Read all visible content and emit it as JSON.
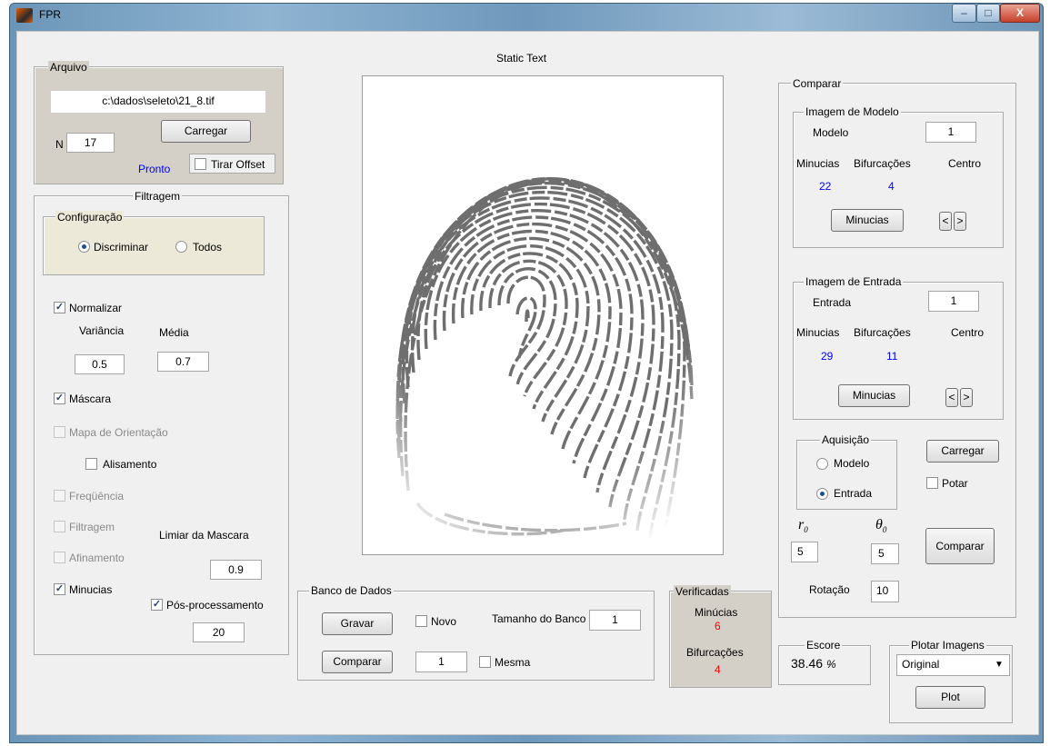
{
  "window": {
    "title": "FPR",
    "minimize": "–",
    "maximize": "□",
    "close": "X"
  },
  "arquivo": {
    "title": "Arquivo",
    "path": "c:\\dados\\seleto\\21_8.tif",
    "n_label": "N",
    "n_value": "17",
    "load_button": "Carregar",
    "status": "Pronto",
    "offset_label": "Tirar Offset"
  },
  "filtragem": {
    "title": "Filtragem",
    "config": {
      "title": "Configuração",
      "option1": "Discriminar",
      "option2": "Todos",
      "selected": "Discriminar"
    },
    "normalizar": "Normalizar",
    "variancia_label": "Variância",
    "media_label": "Média",
    "variancia_value": "0.5",
    "media_value": "0.7",
    "mascara": "Máscara",
    "mapa": "Mapa de Orientação",
    "alisamento": "Alisamento",
    "frequencia": "Freqüência",
    "filtragem_cb": "Filtragem",
    "limiar_label": "Limiar da Mascara",
    "afinamento": "Afinamento",
    "limiar_value": "0.9",
    "minucias": "Minucias",
    "pos": "Pós-processamento",
    "pos_value": "20"
  },
  "center": {
    "static_text": "Static Text"
  },
  "banco": {
    "title": "Banco de Dados",
    "gravar": "Gravar",
    "novo": "Novo",
    "tamanho_label": "Tamanho do Banco",
    "tamanho_value": "1",
    "comparar": "Comparar",
    "index_value": "1",
    "mesma": "Mesma"
  },
  "verificadas": {
    "title": "Verificadas",
    "minucias_label": "Minúcias",
    "minucias_value": "6",
    "bif_label": "Bifurcações",
    "bif_value": "4"
  },
  "comparar": {
    "title": "Comparar",
    "modelo": {
      "title": "Imagem de Modelo",
      "label": "Modelo",
      "value": "1",
      "min_label": "Minucias",
      "bif_label": "Bifurcações",
      "centro_label": "Centro",
      "min_value": "22",
      "bif_value": "4",
      "button": "Minucias",
      "prev": "<",
      "next": ">"
    },
    "entrada": {
      "title": "Imagem de Entrada",
      "label": "Entrada",
      "value": "1",
      "min_label": "Minucias",
      "bif_label": "Bifurcações",
      "centro_label": "Centro",
      "min_value": "29",
      "bif_value": "11",
      "button": "Minucias",
      "prev": "<",
      "next": ">"
    },
    "aquisicao": {
      "title": "Aquisição",
      "option1": "Modelo",
      "option2": "Entrada",
      "selected": "Entrada"
    },
    "carregar": "Carregar",
    "potar": "Potar",
    "r0_label": "r",
    "r0_sub": "0",
    "theta_label": "θ",
    "theta_sub": "0",
    "r0_value": "5",
    "theta_value": "5",
    "comparar_button": "Comparar",
    "rotacao_label": "Rotação",
    "rotacao_value": "10"
  },
  "escore": {
    "title": "Escore",
    "value": "38.46",
    "unit": "%"
  },
  "plotar": {
    "title": "Plotar Imagens",
    "selected": "Original",
    "button": "Plot"
  }
}
